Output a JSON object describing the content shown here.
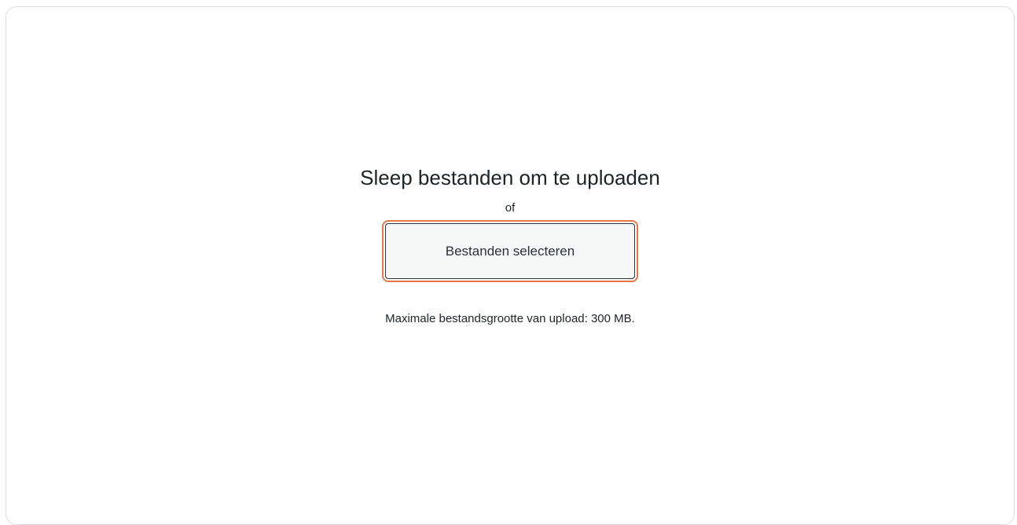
{
  "upload": {
    "title": "Sleep bestanden om te uploaden",
    "or_text": "of",
    "select_button_label": "Bestanden selecteren",
    "max_size_text": "Maximale bestandsgrootte van upload: 300 MB."
  },
  "colors": {
    "highlight": "#e8784a",
    "button_bg": "#f6f7f7",
    "text": "#1d2327"
  }
}
